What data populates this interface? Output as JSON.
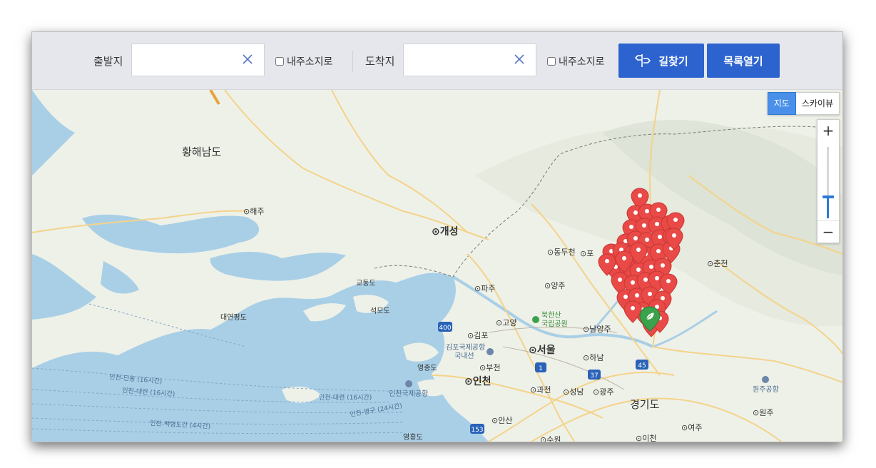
{
  "toolbar": {
    "origin_label": "출발지",
    "origin_value": "",
    "origin_checkbox_label": "내주소지로",
    "destination_label": "도착지",
    "destination_value": "",
    "destination_checkbox_label": "내주소지로",
    "route_button_label": "길찾기",
    "list_button_label": "목록열기",
    "accent_color": "#2d63cf"
  },
  "map_controls": {
    "map_type_active": "지도",
    "map_type_other": "스카이뷰",
    "zoom_in": "+",
    "zoom_out": "−",
    "zoom_level_fraction": 0.7
  },
  "map": {
    "regions": {
      "hwanghae": "황해남도",
      "gyeonggi": "경기도"
    },
    "places": {
      "haeju": "⊙해주",
      "kaesong": "⊙개성",
      "dongducheon": "⊙동두천",
      "pocheon": "⊙포",
      "chuncheon": "⊙춘천",
      "paju": "⊙파주",
      "yangju": "⊙양주",
      "goyang": "⊙고양",
      "gimpo": "⊙김포",
      "seoul": "⊙서울",
      "namyangju": "⊙남양주",
      "hanam": "⊙하남",
      "bucheon": "⊙부천",
      "incheon": "⊙인천",
      "gwacheon": "⊙과천",
      "seongnam": "⊙성남",
      "gwangju": "⊙광주",
      "ansan": "⊙안산",
      "yeoju": "⊙여주",
      "wonju": "⊙원주",
      "icheon": "⊙이천",
      "suwon": "⊙수원"
    },
    "islands": {
      "gyodongdo": "교동도",
      "seongmodo": "석모도",
      "daeyeonpyeongdo": "대연평도",
      "yeongjongdo": "영종도",
      "yeongheungdo": "영흥도"
    },
    "poi": {
      "bukhansan_1": "북한산",
      "bukhansan_2": "국립공원",
      "gimpo_airport_1": "김포국제공항",
      "gimpo_airport_2": "국내선",
      "incheon_airport": "인천국제공항",
      "wonju_airport": "원주공항"
    },
    "ferries": {
      "f1": "인천-단동 (16시간)",
      "f2": "인천-대련 (16시간)",
      "f3": "인천-대련 (16시간)",
      "f4": "인천-영구 (24시간)",
      "f5": "인천-백령도간 (4시간)"
    },
    "routes": {
      "r400": "400",
      "r1": "1",
      "r37": "37",
      "r45": "45",
      "r153": "153"
    },
    "marker_color": "#e94a47",
    "selected_marker_color": "#3aa24a"
  }
}
